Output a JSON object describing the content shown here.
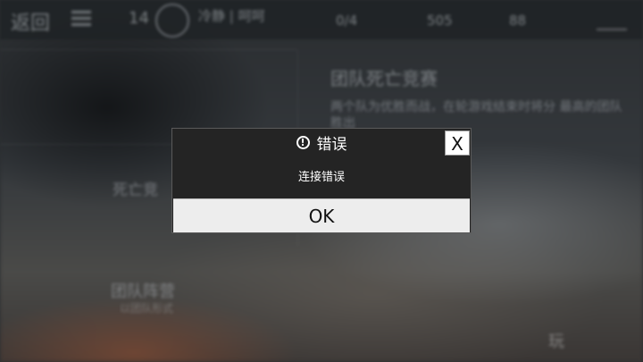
{
  "topbar": {
    "back_label": "返回",
    "level": "14",
    "username": "冷静 | 呵呵",
    "stat_1": "0/4",
    "stat_2": "505",
    "stat_3": "88"
  },
  "mode": {
    "title": "团队死亡竞赛",
    "description": "两个队为优胜而战，在轮游戏结束时将分 最高的团队胜出"
  },
  "side": {
    "item_1": "死亡竞",
    "item_2": "团队阵营",
    "item_2_sub": "以团队形式"
  },
  "corner_label": "玩",
  "dialog": {
    "title": "错误",
    "message": "连接错误",
    "ok_label": "OK",
    "close_label": "X",
    "alert_glyph": "!"
  }
}
